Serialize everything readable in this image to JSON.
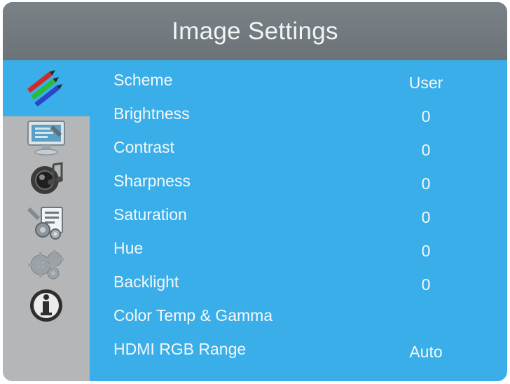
{
  "title": "Image Settings",
  "sidebar": {
    "items": [
      {
        "icon": "picture-pencils-icon",
        "active": true
      },
      {
        "icon": "display-icon",
        "active": false
      },
      {
        "icon": "speaker-icon",
        "active": false
      },
      {
        "icon": "setup-tools-icon",
        "active": false
      },
      {
        "icon": "advanced-gears-icon",
        "active": false
      },
      {
        "icon": "info-icon",
        "active": false
      }
    ]
  },
  "menu": {
    "items": [
      {
        "label": "Scheme",
        "value": "User"
      },
      {
        "label": "Brightness",
        "value": "0"
      },
      {
        "label": "Contrast",
        "value": "0"
      },
      {
        "label": "Sharpness",
        "value": "0"
      },
      {
        "label": "Saturation",
        "value": "0"
      },
      {
        "label": "Hue",
        "value": "0"
      },
      {
        "label": "Backlight",
        "value": "0"
      },
      {
        "label": "Color Temp & Gamma",
        "value": ""
      },
      {
        "label": "HDMI RGB Range",
        "value": "Auto"
      }
    ]
  },
  "colors": {
    "panel_blue": "#3aaee9",
    "title_gray": "#6f777c",
    "sidebar_gray": "#b4b6b8",
    "text": "#f4f8fa"
  }
}
